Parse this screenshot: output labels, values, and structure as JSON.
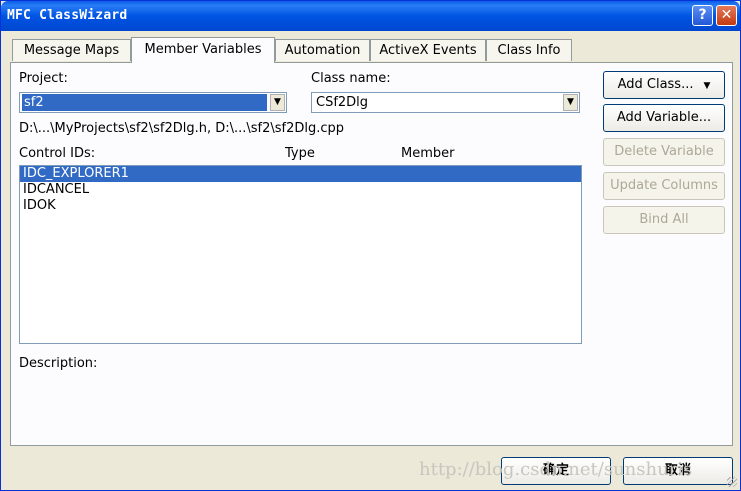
{
  "window": {
    "title": "MFC ClassWizard",
    "help_glyph": "?",
    "close_glyph": "✕"
  },
  "tabs": [
    {
      "label": "Message Maps",
      "active": false
    },
    {
      "label": "Member Variables",
      "active": true
    },
    {
      "label": "Automation",
      "active": false
    },
    {
      "label": "ActiveX Events",
      "active": false
    },
    {
      "label": "Class Info",
      "active": false
    }
  ],
  "project": {
    "label": "Project:",
    "value": "sf2"
  },
  "class_name": {
    "label": "Class name:",
    "value": "CSf2Dlg"
  },
  "file_path": "D:\\...\\MyProjects\\sf2\\sf2Dlg.h, D:\\...\\sf2\\sf2Dlg.cpp",
  "list_headers": {
    "control_ids": "Control IDs:",
    "type": "Type",
    "member": "Member"
  },
  "control_ids": [
    {
      "id": "IDC_EXPLORER1",
      "selected": true
    },
    {
      "id": "IDCANCEL",
      "selected": false
    },
    {
      "id": "IDOK",
      "selected": false
    }
  ],
  "description_label": "Description:",
  "buttons": {
    "add_class": "Add Class...",
    "add_variable": "Add Variable...",
    "delete_variable": "Delete Variable",
    "update_columns": "Update Columns",
    "bind_all": "Bind All"
  },
  "bottom_buttons": {
    "ok": "确定",
    "cancel": "取消"
  },
  "watermark": "http://blog.csdn.net/sunshuris",
  "icons": {
    "dropdown": "▼"
  },
  "colors": {
    "titlebar": "#0054e3",
    "selection": "#316ac5",
    "dialog_bg": "#ece9d8"
  }
}
